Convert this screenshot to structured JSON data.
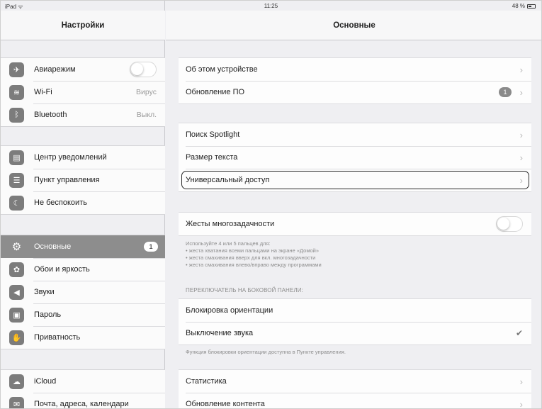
{
  "status_bar": {
    "device": "iPad",
    "time": "11:25",
    "battery": "48 %"
  },
  "sidebar": {
    "title": "Настройки",
    "groups": [
      [
        {
          "label": "Авиарежим",
          "icon": "airplane-icon",
          "glyph": "✈",
          "toggle": false
        },
        {
          "label": "Wi-Fi",
          "icon": "wifi-icon",
          "glyph": "≋",
          "value": "Вирус"
        },
        {
          "label": "Bluetooth",
          "icon": "bluetooth-icon",
          "glyph": "ᛒ",
          "value": "Выкл."
        }
      ],
      [
        {
          "label": "Центр уведомлений",
          "icon": "notifications-icon",
          "glyph": "▤"
        },
        {
          "label": "Пункт управления",
          "icon": "control-center-icon",
          "glyph": "☰"
        },
        {
          "label": "Не беспокоить",
          "icon": "moon-icon",
          "glyph": "☾"
        }
      ],
      [
        {
          "label": "Основные",
          "icon": "gear-icon",
          "glyph": "⚙",
          "badge": "1",
          "selected": true
        },
        {
          "label": "Обои и яркость",
          "icon": "wallpaper-icon",
          "glyph": "✿"
        },
        {
          "label": "Звуки",
          "icon": "speaker-icon",
          "glyph": "◀"
        },
        {
          "label": "Пароль",
          "icon": "lock-icon",
          "glyph": "▣"
        },
        {
          "label": "Приватность",
          "icon": "hand-icon",
          "glyph": "✋"
        }
      ],
      [
        {
          "label": "iCloud",
          "icon": "cloud-icon",
          "glyph": "☁"
        },
        {
          "label": "Почта, адреса, календари",
          "icon": "mail-icon",
          "glyph": "✉"
        }
      ]
    ]
  },
  "main": {
    "title": "Основные",
    "group1": [
      {
        "label": "Об этом устройстве"
      },
      {
        "label": "Обновление ПО",
        "badge": "1"
      }
    ],
    "group2": [
      {
        "label": "Поиск Spotlight"
      },
      {
        "label": "Размер текста"
      },
      {
        "label": "Универсальный доступ",
        "highlighted": true
      }
    ],
    "multitasking": {
      "label": "Жесты многозадачности",
      "toggle": false
    },
    "multitasking_note": [
      "Используйте 4 или 5 пальцев для:",
      "• жеста хватания всеми пальцами на экране «Домой»",
      "• жеста смахивания вверх для вкл. многозадачности",
      "• жеста смахивания влево/вправо между программами"
    ],
    "side_switch_header": "ПЕРЕКЛЮЧАТЕЛЬ НА БОКОВОЙ ПАНЕЛИ:",
    "side_switch": [
      {
        "label": "Блокировка ориентации",
        "checked": false
      },
      {
        "label": "Выключение звука",
        "checked": true
      }
    ],
    "side_switch_note": "Функция блокировки ориентации доступна в Пункте управления.",
    "group4": [
      {
        "label": "Статистика"
      },
      {
        "label": "Обновление контента"
      }
    ]
  }
}
